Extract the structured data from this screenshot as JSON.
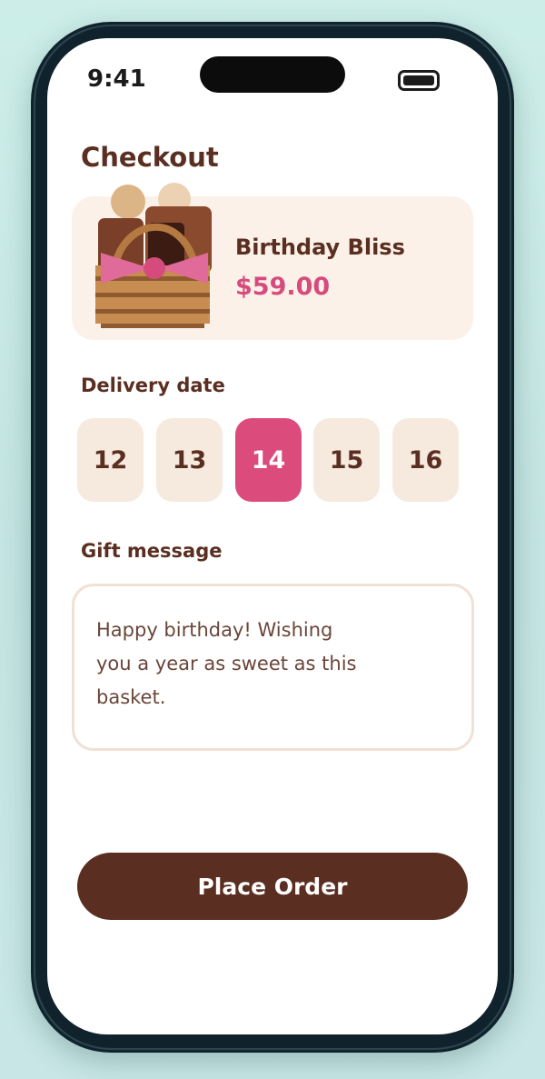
{
  "status_bar": {
    "time": "9:41"
  },
  "page": {
    "title": "Checkout"
  },
  "product": {
    "name": "Birthday Bliss",
    "price": "$59.00",
    "image_icon": "gift-basket-icon"
  },
  "delivery": {
    "label": "Delivery date",
    "dates": [
      "12",
      "13",
      "14",
      "15",
      "16"
    ],
    "selected": "14"
  },
  "gift_message": {
    "label": "Gift message",
    "value": "Happy birthday! Wishing you a year as sweet as this basket."
  },
  "actions": {
    "place_order_label": "Place Order"
  },
  "colors": {
    "brand_brown": "#5a2e20",
    "accent_pink": "#db4c7c",
    "card_cream": "#fbf1e8",
    "chip_bg": "#f6e9de"
  }
}
